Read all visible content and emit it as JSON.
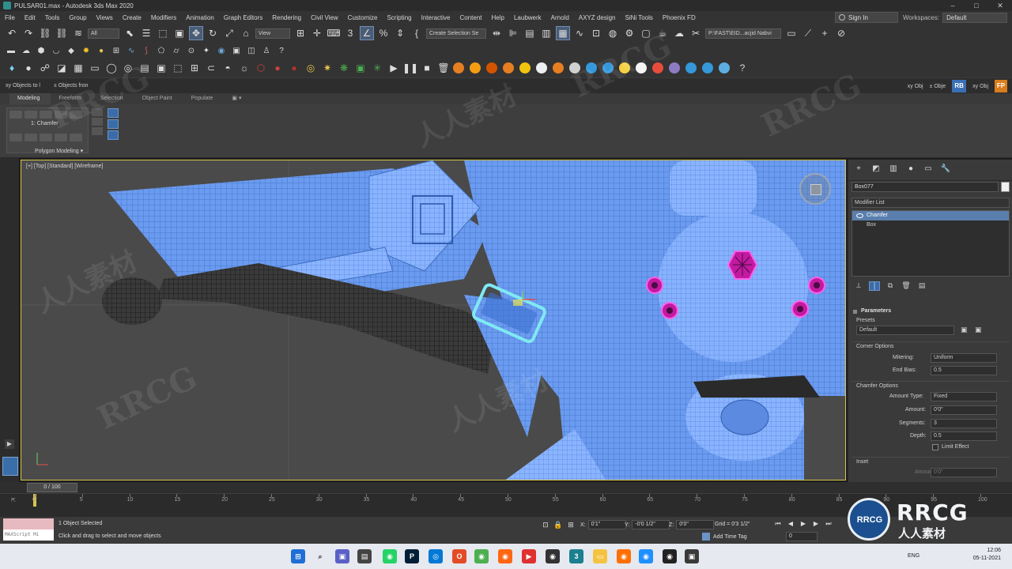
{
  "window": {
    "title": "PULSAR01.max - Autodesk 3ds Max 2020",
    "min": "–",
    "max": "□",
    "close": "✕"
  },
  "menu": {
    "items": [
      "File",
      "Edit",
      "Tools",
      "Group",
      "Views",
      "Create",
      "Modifiers",
      "Animation",
      "Graph Editors",
      "Rendering",
      "Civil View",
      "Customize",
      "Scripting",
      "Interactive",
      "Content",
      "Help",
      "Laubwerk",
      "Arnold",
      "AXYZ design",
      "SiNi Tools",
      "Phoenix FD"
    ],
    "sign_in": "Sign In",
    "workspaces_label": "Workspaces:",
    "workspaces_value": "Default"
  },
  "toolbar": {
    "filter": "All",
    "ref_coord": "View",
    "selection_set": "Create Selection Se",
    "path": "P:\\FAST\\EID...acjid Nabvi"
  },
  "scene_bar": {
    "left1": "xy Objects to l",
    "left2": "± Objects fron",
    "r1": "xy Obj",
    "r2": "± Obje",
    "rb": "RB",
    "r3": "xy Obj",
    "fp": "FP"
  },
  "ribbon": {
    "tabs": [
      "Modeling",
      "Freeform",
      "Selection",
      "Object Paint",
      "Populate"
    ],
    "chamfer_label": "1: Chamfer",
    "panel_label": "Polygon Modeling ▾"
  },
  "viewport": {
    "label": "[+] [Top] [Standard] [Wireframe]"
  },
  "command_panel": {
    "object_name": "Box077",
    "modifier_list": "Modifier List",
    "stack": [
      "Chamfer",
      "Box"
    ],
    "parameters_title": "Parameters",
    "presets_label": "Presets",
    "presets_value": "Default",
    "corner_options": "Corner Options",
    "mitering_label": "Mitering:",
    "mitering_value": "Uniform",
    "end_bias_label": "End Bias:",
    "end_bias_value": "0.5",
    "chamfer_options": "Chamfer Options",
    "amount_type_label": "Amount Type:",
    "amount_type_value": "Fixed",
    "amount_label": "Amount:",
    "amount_value": "0'0\"",
    "segments_label": "Segments:",
    "segments_value": "3",
    "depth_label": "Depth:",
    "depth_value": "0.5",
    "limit_effect": "Limit Effect",
    "inset": "Inset",
    "amount2_label": "Amount:",
    "amount2_value": "0'0\""
  },
  "timeline": {
    "slider": "0 / 100",
    "ticks": [
      "0",
      "5",
      "10",
      "15",
      "20",
      "25",
      "30",
      "35",
      "40",
      "45",
      "50",
      "55",
      "60",
      "65",
      "70",
      "75",
      "80",
      "85",
      "90",
      "95",
      "100"
    ],
    "corner": "⇱"
  },
  "status": {
    "maxscript": "MAXScript Mi",
    "selected": "1 Object Selected",
    "hint": "Click and drag to select and move objects",
    "x_label": "X:",
    "x_value": "0'1\"",
    "y_label": "Y:",
    "y_value": "-0'0 1/2\"",
    "z_label": "Z:",
    "z_value": "0'0\"",
    "grid": "Grid = 0'3 1/2\"",
    "add_time_tag": "Add Time Tag",
    "frame": "0"
  },
  "taskbar": {
    "lang": "ENG",
    "time": "12:06",
    "date": "05-11-2021"
  },
  "watermark": {
    "brand": "RRCG",
    "sub": "人人素材"
  },
  "colors": {
    "wire_blue": "#6b9bf0",
    "selection": "#7fe9f2",
    "viewport_bg": "#4a4a4a",
    "viewport_border": "#d8c54a",
    "helper_magenta": "#c21aa0"
  }
}
